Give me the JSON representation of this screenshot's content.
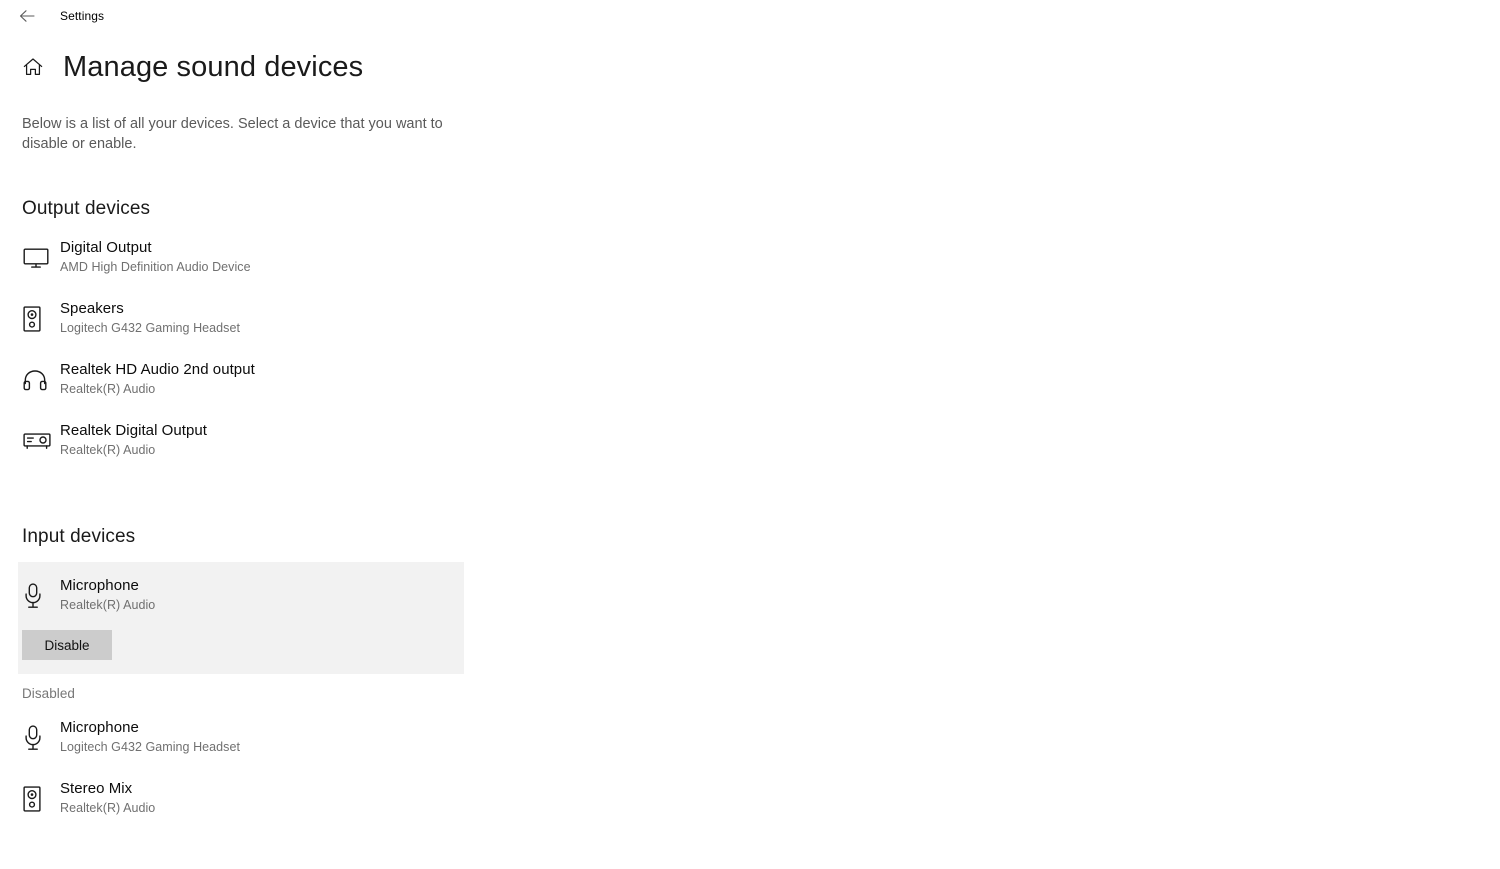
{
  "titlebar": {
    "back_icon": "back-arrow-icon",
    "label": "Settings"
  },
  "header": {
    "home_icon": "home-icon",
    "title": "Manage sound devices",
    "description": "Below is a list of all your devices. Select a device that you want to disable or enable."
  },
  "output_section": {
    "title": "Output devices",
    "devices": [
      {
        "icon": "monitor-icon",
        "name": "Digital Output",
        "sub": "AMD High Definition Audio Device"
      },
      {
        "icon": "speaker-icon",
        "name": "Speakers",
        "sub": "Logitech G432 Gaming Headset"
      },
      {
        "icon": "headphones-icon",
        "name": "Realtek HD Audio 2nd output",
        "sub": "Realtek(R) Audio"
      },
      {
        "icon": "receiver-icon",
        "name": "Realtek Digital Output",
        "sub": "Realtek(R) Audio"
      }
    ]
  },
  "input_section": {
    "title": "Input devices",
    "selected_device": {
      "icon": "microphone-icon",
      "name": "Microphone",
      "sub": "Realtek(R) Audio",
      "action_label": "Disable"
    },
    "disabled_group_label": "Disabled",
    "disabled_devices": [
      {
        "icon": "microphone-icon",
        "name": "Microphone",
        "sub": "Logitech G432 Gaming Headset"
      },
      {
        "icon": "speaker-icon",
        "name": "Stereo Mix",
        "sub": "Realtek(R) Audio"
      }
    ]
  },
  "colors": {
    "page_background": "#ffffff",
    "selected_panel": "#f2f2f2",
    "button_background": "#cccccc",
    "primary_text": "#0c0c0c",
    "secondary_text": "#707070"
  }
}
